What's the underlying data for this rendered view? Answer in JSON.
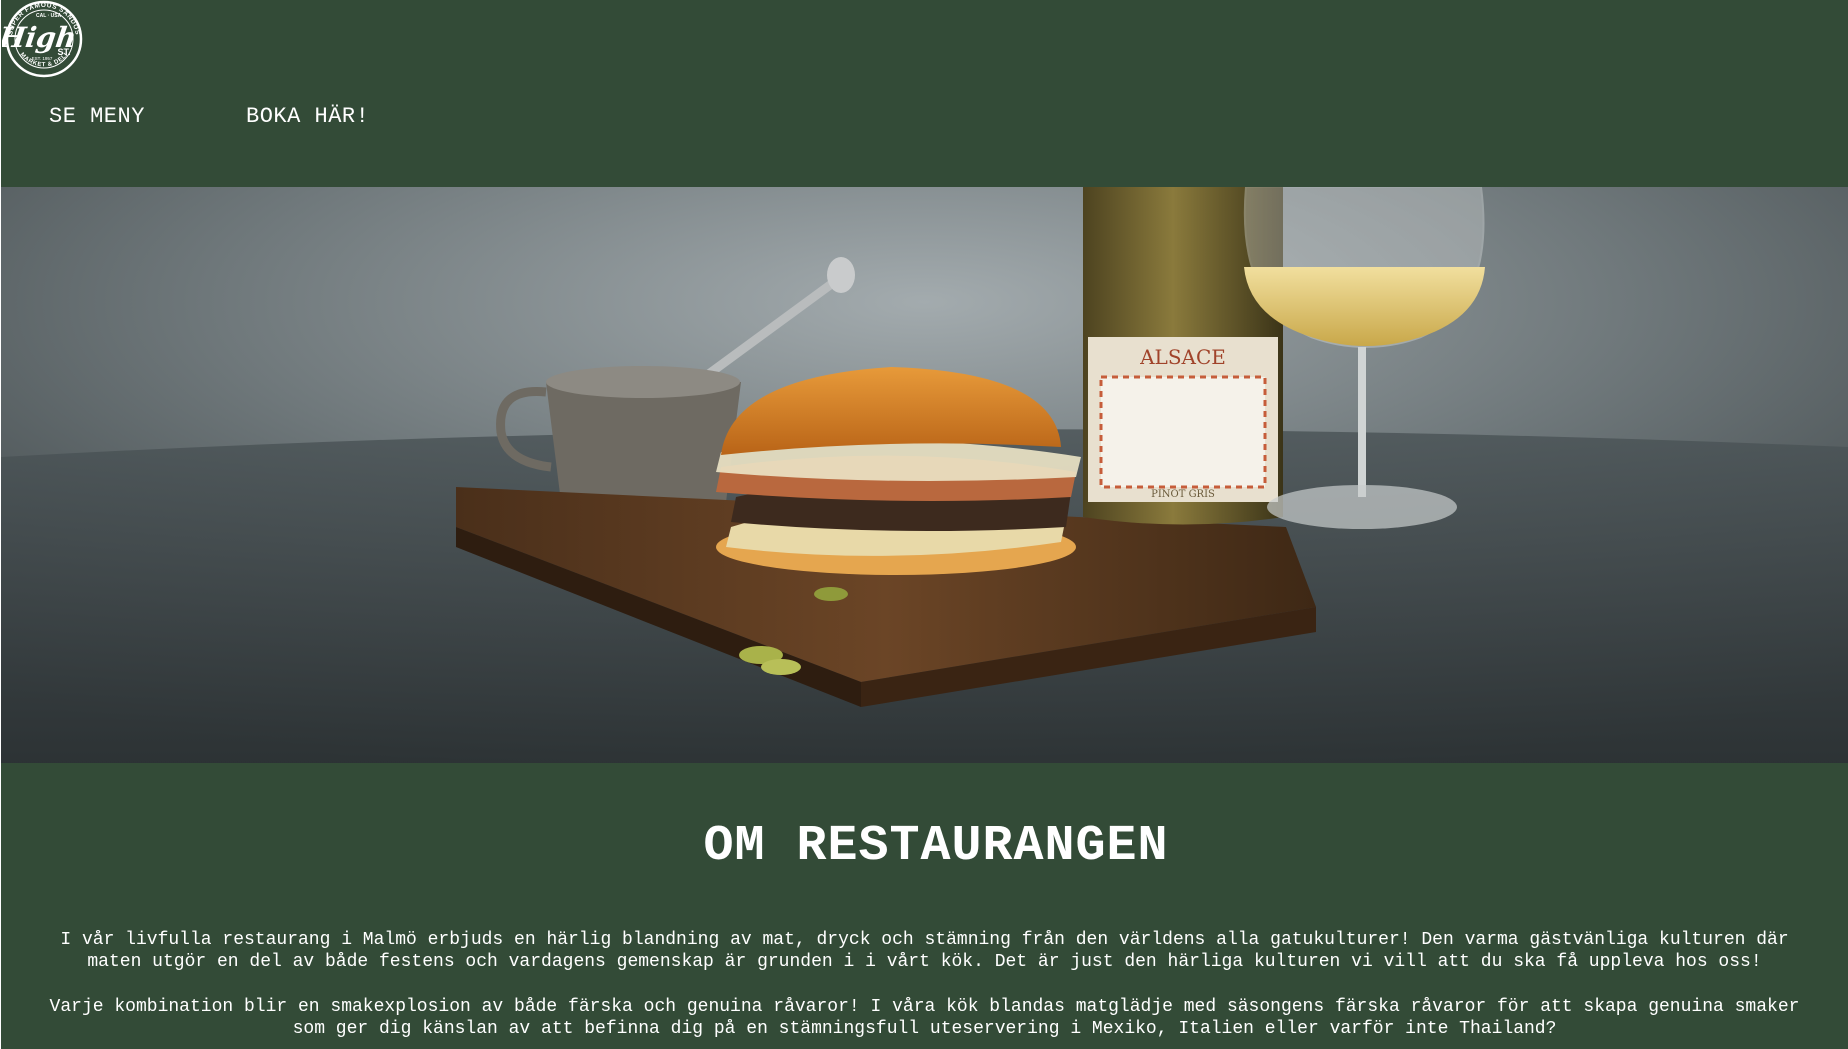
{
  "colors": {
    "background": "#334b37",
    "text": "#ffffff"
  },
  "logo": {
    "text": "High",
    "badge": "ST.",
    "ring_top": "SUPER FAMOUS SANDOS",
    "ring_bottom": "MARKET & DELI",
    "est": "EST. 1957",
    "region": "CAL · USA"
  },
  "nav": {
    "menu_label": "SE MENY",
    "book_label": "BOKA HÄR!"
  },
  "hero": {
    "bottle_label": "ALSACE",
    "bottle_sub": "PINOT GRIS"
  },
  "about": {
    "title": "OM RESTAURANGEN",
    "paragraph1_line1": "I vår livfulla restaurang i Malmö erbjuds en härlig blandning av mat, dryck och stämning från den världens alla gatukulturer! Den varma gästvänliga kulturen där",
    "paragraph1_line2": "maten utgör en del av både festens och vardagens gemenskap är grunden i i vårt kök. Det är just den härliga kulturen vi vill att du ska få uppleva hos oss!",
    "paragraph2_line1": "Varje kombination blir en smakexplosion av både färska och genuina råvaror! I våra kök blandas matglädje med säsongens färska råvaror för att skapa genuina smaker",
    "paragraph2_line2": "som ger dig känslan av att befinna dig på en stämningsfull uteservering i Mexiko, Italien eller varför inte Thailand?"
  }
}
